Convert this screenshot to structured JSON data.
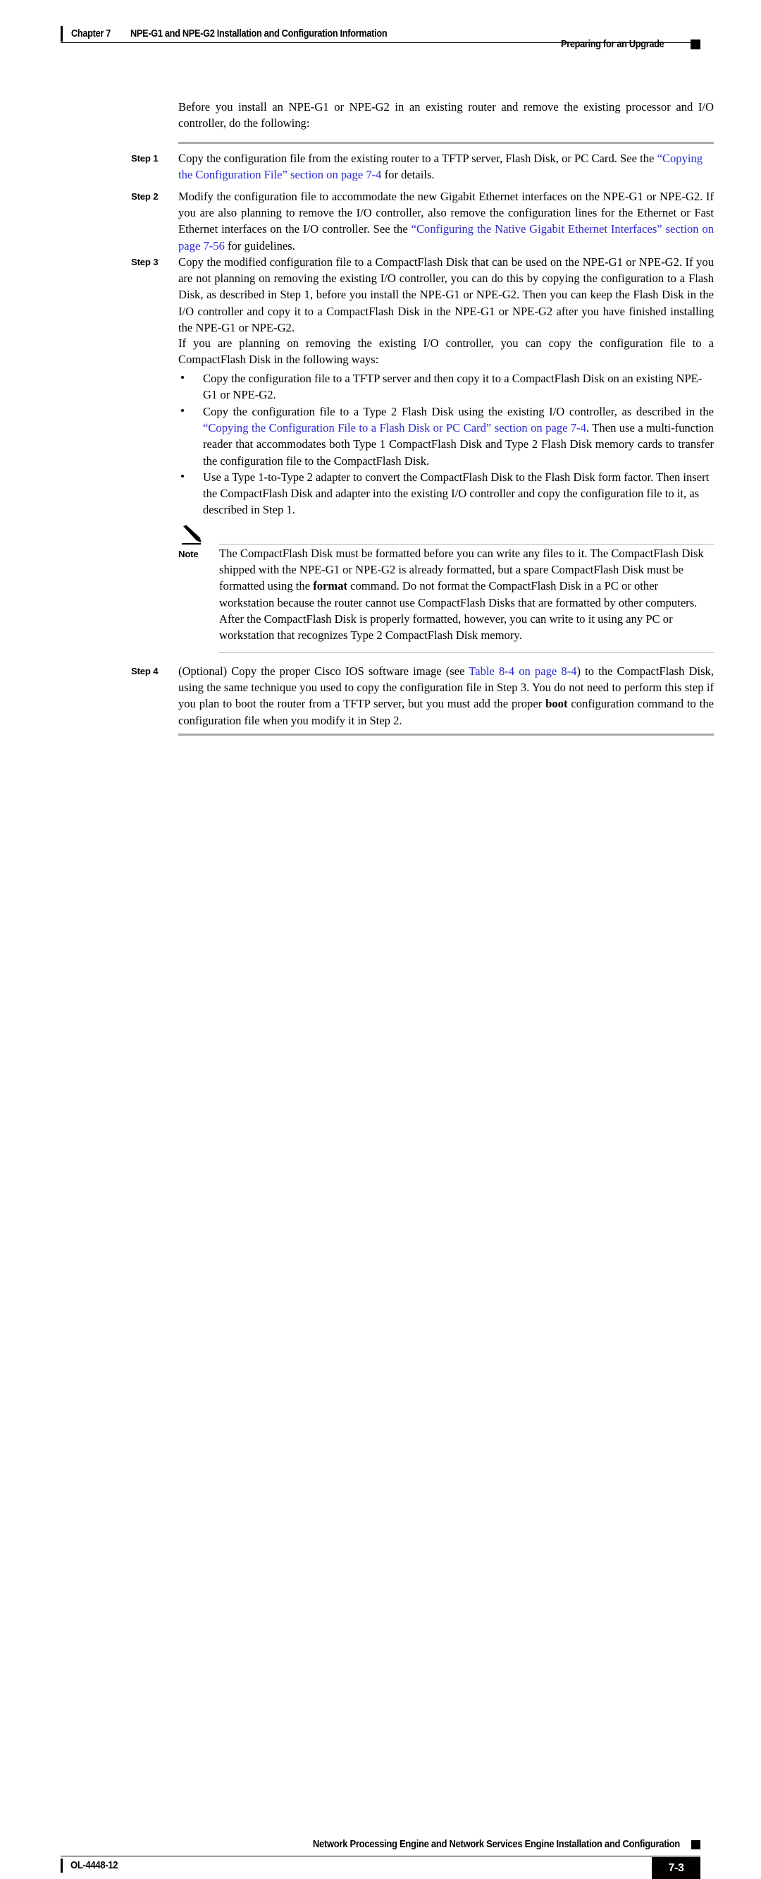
{
  "header": {
    "chapter_label": "Chapter 7",
    "chapter_title": "NPE-G1 and NPE-G2 Installation and Configuration Information",
    "section_title": "Preparing for an Upgrade"
  },
  "intro": {
    "text": "Before you install an NPE-G1 or NPE-G2 in an existing router and remove the existing processor and I/O controller, do the following:"
  },
  "steps": [
    {
      "label": "Step 1",
      "text_before": "Copy the configuration file from the existing router to a TFTP server, Flash Disk, or PC Card. See the ",
      "link": "“Copying the Configuration File” section on page 7-4",
      "text_after": " for details."
    },
    {
      "label": "Step 2",
      "text_before": "Modify the configuration file to accommodate the new Gigabit Ethernet interfaces on the NPE-G1 or NPE-G2. If you are also planning to remove the I/O controller, also remove the configuration lines for the Ethernet or Fast Ethernet interfaces on the I/O controller. See the ",
      "link": "“Configuring the Native Gigabit Ethernet Interfaces” section on page 7-56",
      "text_after": " for guidelines."
    },
    {
      "label": "Step 3",
      "text": "Copy the modified configuration file to a CompactFlash Disk that can be used on the NPE-G1 or NPE-G2. If you are not planning on removing the existing I/O controller, you can do this by copying the configuration to a Flash Disk, as described in Step 1, before you install the NPE-G1 or NPE-G2. Then you can keep the Flash Disk in the I/O controller and copy it to a CompactFlash Disk in the NPE-G1 or NPE-G2 after you have finished installing the NPE-G1 or NPE-G2."
    }
  ],
  "mid_paragraph": {
    "text": "If you are planning on removing the existing I/O controller, you can copy the configuration file to a CompactFlash Disk in the following ways:"
  },
  "bullets": [
    {
      "text": "Copy the configuration file to a TFTP server and then copy it to a CompactFlash Disk on an existing NPE-G1 or NPE-G2."
    },
    {
      "text_before": "Copy the configuration file to a Type 2 Flash Disk using the existing I/O controller, as described in the ",
      "link": "“Copying the Configuration File to a Flash Disk or PC Card” section on page 7-4",
      "text_after": ". Then use a multi-function reader that accommodates both Type 1 CompactFlash Disk and Type 2 Flash Disk memory cards to transfer the configuration file to the CompactFlash Disk."
    },
    {
      "text": "Use a Type 1-to-Type 2 adapter to convert the CompactFlash Disk to the Flash Disk form factor. Then insert the CompactFlash Disk and adapter into the existing I/O controller and copy the configuration file to it, as described in Step 1."
    }
  ],
  "note": {
    "label": "Note",
    "icon": "pencil-icon",
    "text_before": "The CompactFlash Disk must be formatted before you can write any files to it. The CompactFlash Disk shipped with the NPE-G1 or NPE-G2 is already formatted, but a spare CompactFlash Disk must be formatted using the ",
    "bold": "format",
    "text_after": " command. Do not format the CompactFlash Disk in a PC or other workstation because the router cannot use CompactFlash Disks that are formatted by other computers. After the CompactFlash Disk is properly formatted, however, you can write to it using any PC or workstation that recognizes Type 2 CompactFlash Disk memory."
  },
  "step4": {
    "label": "Step 4",
    "text_before": "(Optional) Copy the proper Cisco IOS software image (see ",
    "link": "Table 8-4 on page 8-4",
    "text_mid": ") to the CompactFlash Disk, using the same technique you used to copy the configuration file in Step 3. You do not need to perform this step if you plan to boot the router from a TFTP server, but you must add the proper ",
    "bold": "boot",
    "text_after": " configuration command to the configuration file when you modify it in Step 2."
  },
  "footer": {
    "doc_title": "Network Processing Engine and Network Services Engine Installation and Configuration",
    "doc_id": "OL-4448-12",
    "page_number": "7-3"
  },
  "colors": {
    "link": "#2a2ad0",
    "rule_gray": "#a9a9a9",
    "note_rule": "#b4b4b4",
    "ink": "#000000"
  }
}
